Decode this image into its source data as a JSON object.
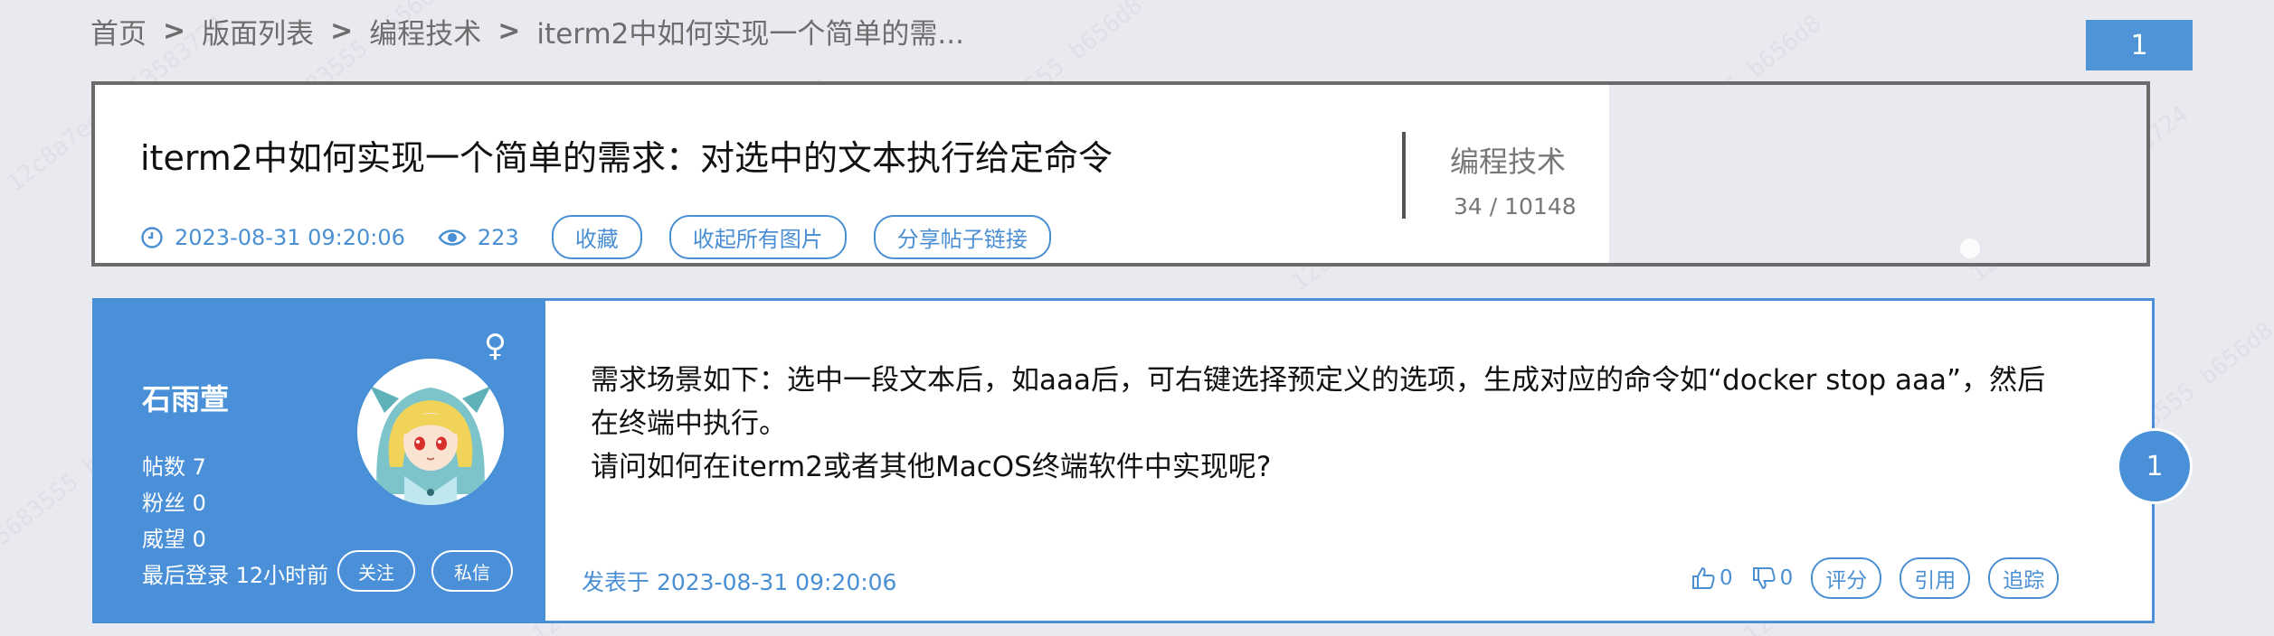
{
  "breadcrumb": {
    "items": [
      "首页",
      "版面列表",
      "编程技术",
      "iterm2中如何实现一个简单的需..."
    ]
  },
  "page_badge": "1",
  "thread": {
    "title": "iterm2中如何实现一个简单的需求：对选中的文本执行给定命令",
    "datetime": "2023-08-31 09:20:06",
    "views": "223",
    "buttons": {
      "favorite": "收藏",
      "collapse_images": "收起所有图片",
      "share_link": "分享帖子链接"
    },
    "board": "编程技术",
    "count": "34 / 10148"
  },
  "post": {
    "author": {
      "name": "石雨萱",
      "gender_symbol": "♀",
      "stats": [
        "帖数 7",
        "粉丝 0",
        "威望 0",
        "最后登录 12小时前"
      ],
      "follow_label": "关注",
      "message_label": "私信"
    },
    "content": [
      "需求场景如下：选中一段文本后，如aaa后，可右键选择预定义的选项，生成对应的命令如“docker stop aaa”，然后",
      "在终端中执行。",
      "请问如何在iterm2或者其他MacOS终端软件中实现呢?"
    ],
    "posted_at": "发表于 2023-08-31 09:20:06",
    "likes": "0",
    "dislikes": "0",
    "action_labels": {
      "rate": "评分",
      "quote": "引用",
      "track": "追踪"
    },
    "floor": "1"
  },
  "colors": {
    "accent": "#4a90d9",
    "background": "#e9eaef",
    "title_border": "#6b6b6b"
  },
  "icons": [
    "clock-icon",
    "eye-icon",
    "female-icon",
    "thumbs-up-icon",
    "thumbs-down-icon",
    "chevron-right-icon"
  ]
}
